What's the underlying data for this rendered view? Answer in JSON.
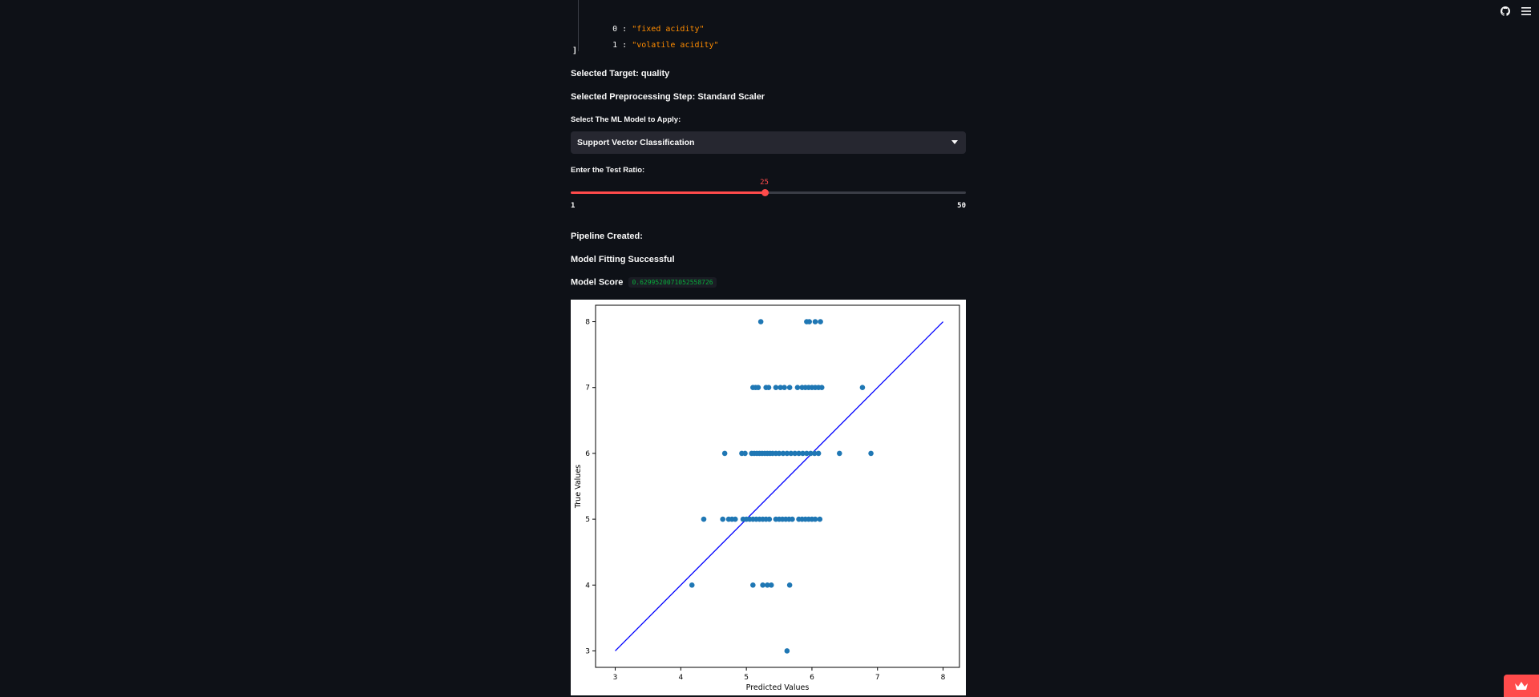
{
  "json_preview": {
    "items": [
      {
        "index": "0",
        "value": "\"fixed acidity\""
      },
      {
        "index": "1",
        "value": "\"volatile acidity\""
      }
    ],
    "close_bracket": "]"
  },
  "selected_target": "Selected Target: quality",
  "selected_preprocessing": "Selected Preprocessing Step: Standard Scaler",
  "model_select": {
    "label": "Select The ML Model to Apply:",
    "value": "Support Vector Classification"
  },
  "test_ratio": {
    "label": "Enter the Test Ratio:",
    "value": 25,
    "min": "1",
    "max": "50",
    "value_text": "25",
    "fraction": 0.49
  },
  "pipeline_created": "Pipeline Created:",
  "model_fitting": "Model Fitting Successful",
  "model_score": {
    "label": "Model Score",
    "value": "0.6299520071052558726"
  },
  "colors": {
    "background": "#0e1117",
    "accent": "#ff4b4b",
    "json_string": "#ff8c00",
    "score": "#09ab3b",
    "points": "#1f77b4",
    "line": "#0000ff"
  },
  "icons": [
    "github-icon",
    "hamburger-menu-icon",
    "crown-icon"
  ],
  "chart_data": {
    "type": "scatter",
    "xlabel": "Predicted Values",
    "ylabel": "True Values",
    "xlim": [
      2.7,
      8.25
    ],
    "ylim": [
      2.75,
      8.25
    ],
    "xticks": [
      3,
      4,
      5,
      6,
      7,
      8
    ],
    "yticks": [
      3,
      4,
      5,
      6,
      7,
      8
    ],
    "grid": false,
    "reference_line": {
      "x": [
        3,
        8
      ],
      "y": [
        3,
        8
      ]
    },
    "points": [
      [
        5.22,
        8
      ],
      [
        5.92,
        8
      ],
      [
        5.96,
        8
      ],
      [
        6.05,
        8
      ],
      [
        6.13,
        8
      ],
      [
        5.1,
        7
      ],
      [
        5.14,
        7
      ],
      [
        5.18,
        7
      ],
      [
        5.3,
        7
      ],
      [
        5.34,
        7
      ],
      [
        5.45,
        7
      ],
      [
        5.52,
        7
      ],
      [
        5.58,
        7
      ],
      [
        5.66,
        7
      ],
      [
        5.78,
        7
      ],
      [
        5.85,
        7
      ],
      [
        5.9,
        7
      ],
      [
        5.95,
        7
      ],
      [
        6.0,
        7
      ],
      [
        6.05,
        7
      ],
      [
        6.1,
        7
      ],
      [
        6.15,
        7
      ],
      [
        6.77,
        7
      ],
      [
        4.67,
        6
      ],
      [
        4.93,
        6
      ],
      [
        4.98,
        6
      ],
      [
        5.08,
        6
      ],
      [
        5.12,
        6
      ],
      [
        5.16,
        6
      ],
      [
        5.2,
        6
      ],
      [
        5.24,
        6
      ],
      [
        5.28,
        6
      ],
      [
        5.32,
        6
      ],
      [
        5.36,
        6
      ],
      [
        5.4,
        6
      ],
      [
        5.45,
        6
      ],
      [
        5.5,
        6
      ],
      [
        5.56,
        6
      ],
      [
        5.62,
        6
      ],
      [
        5.68,
        6
      ],
      [
        5.74,
        6
      ],
      [
        5.8,
        6
      ],
      [
        5.86,
        6
      ],
      [
        5.92,
        6
      ],
      [
        5.98,
        6
      ],
      [
        6.04,
        6
      ],
      [
        6.1,
        6
      ],
      [
        6.42,
        6
      ],
      [
        6.9,
        6
      ],
      [
        4.35,
        5
      ],
      [
        4.64,
        5
      ],
      [
        4.73,
        5
      ],
      [
        4.78,
        5
      ],
      [
        4.83,
        5
      ],
      [
        4.95,
        5
      ],
      [
        5.0,
        5
      ],
      [
        5.05,
        5
      ],
      [
        5.1,
        5
      ],
      [
        5.15,
        5
      ],
      [
        5.2,
        5
      ],
      [
        5.25,
        5
      ],
      [
        5.3,
        5
      ],
      [
        5.35,
        5
      ],
      [
        5.45,
        5
      ],
      [
        5.5,
        5
      ],
      [
        5.55,
        5
      ],
      [
        5.6,
        5
      ],
      [
        5.65,
        5
      ],
      [
        5.7,
        5
      ],
      [
        5.8,
        5
      ],
      [
        5.85,
        5
      ],
      [
        5.9,
        5
      ],
      [
        5.95,
        5
      ],
      [
        6.0,
        5
      ],
      [
        6.05,
        5
      ],
      [
        6.12,
        5
      ],
      [
        4.17,
        4
      ],
      [
        5.1,
        4
      ],
      [
        5.25,
        4
      ],
      [
        5.32,
        4
      ],
      [
        5.38,
        4
      ],
      [
        5.66,
        4
      ],
      [
        5.62,
        3
      ]
    ]
  }
}
